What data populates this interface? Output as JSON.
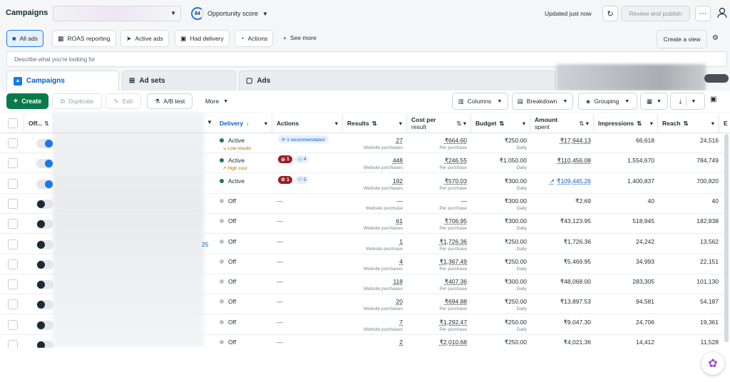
{
  "header": {
    "title": "Campaigns",
    "opportunity_score_value": "84",
    "opportunity_score_label": "Opportunity score",
    "updated_text": "Updated just now",
    "review_publish_label": "Review and publish",
    "more_label": "···"
  },
  "filters": {
    "tabs": [
      {
        "label": "All ads",
        "icon": "folder-icon"
      },
      {
        "label": "ROAS reporting",
        "icon": "report-icon"
      },
      {
        "label": "Active ads",
        "icon": "send-icon"
      },
      {
        "label": "Had delivery",
        "icon": "box-icon"
      },
      {
        "label": "Actions",
        "icon": "actions-icon"
      }
    ],
    "see_more_label": "See more",
    "create_view_label": "Create a view"
  },
  "search": {
    "placeholder": "Describe what you're looking for"
  },
  "level_tabs": [
    {
      "label": "Campaigns"
    },
    {
      "label": "Ad sets"
    },
    {
      "label": "Ads"
    }
  ],
  "toolbar": {
    "create_label": "Create",
    "duplicate_label": "Duplicate",
    "edit_label": "Edit",
    "ab_test_label": "A/B test",
    "more_label": "More",
    "columns_label": "Columns",
    "breakdown_label": "Breakdown",
    "grouping_label": "Grouping"
  },
  "table": {
    "columns": {
      "off": "Off...",
      "delivery": "Delivery",
      "actions": "Actions",
      "results": "Results",
      "cost_per_result_line1": "Cost per",
      "cost_per_result_line2": "result",
      "budget": "Budget",
      "amount_spent_line1": "Amount",
      "amount_spent_line2": "spent",
      "impressions": "Impressions",
      "reach": "Reach",
      "extra": "E"
    },
    "rows": [
      {
        "toggle": "on",
        "id_text": "",
        "delivery": "Active",
        "delivery_note": "↘ Low results",
        "actions_kind": "recommendation",
        "rec_text": "⟳ 1 recommendation",
        "red_count": "",
        "people_count": "",
        "results": "27",
        "results_sub": "Website purchases",
        "cost": "₹664.60",
        "cost_sub": "Per purchase",
        "budget": "₹250.00",
        "budget_sub": "Daily",
        "amount": "₹17,944.13",
        "amount_trend": false,
        "impressions": "66,618",
        "reach": "24,516"
      },
      {
        "toggle": "on",
        "id_text": "",
        "delivery": "Active",
        "delivery_note": "↗ High cost",
        "actions_kind": "badges",
        "rec_text": "",
        "red_count": "1",
        "people_count": "4",
        "results": "448",
        "results_sub": "Website purchases",
        "cost": "₹246.55",
        "cost_sub": "Per purchase",
        "budget": "₹1,050.00",
        "budget_sub": "Daily",
        "amount": "₹110,456.08",
        "amount_trend": false,
        "impressions": "1,554,670",
        "reach": "784,749"
      },
      {
        "toggle": "on",
        "id_text": "",
        "delivery": "Active",
        "delivery_note": "",
        "actions_kind": "badges",
        "rec_text": "",
        "red_count": "1",
        "people_count": "5",
        "results": "192",
        "results_sub": "Website purchases",
        "cost": "₹570.03",
        "cost_sub": "Per purchase",
        "budget": "₹300.00",
        "budget_sub": "Daily",
        "amount": "₹109,445.26",
        "amount_trend": true,
        "impressions": "1,400,837",
        "reach": "700,820"
      },
      {
        "toggle": "off",
        "id_text": "",
        "delivery": "Off",
        "delivery_note": "",
        "actions_kind": "dash",
        "rec_text": "",
        "red_count": "",
        "people_count": "",
        "results": "—",
        "results_sub": "Website purchase",
        "cost": "—",
        "cost_sub": "Per purchase",
        "budget": "₹300.00",
        "budget_sub": "Daily",
        "amount": "₹2.69",
        "amount_trend": false,
        "impressions": "40",
        "reach": "40"
      },
      {
        "toggle": "off",
        "id_text": "",
        "delivery": "Off",
        "delivery_note": "",
        "actions_kind": "dash",
        "rec_text": "",
        "red_count": "",
        "people_count": "",
        "results": "61",
        "results_sub": "Website purchases",
        "cost": "₹706.95",
        "cost_sub": "Per purchase",
        "budget": "₹300.00",
        "budget_sub": "Daily",
        "amount": "₹43,123.95",
        "amount_trend": false,
        "impressions": "518,945",
        "reach": "182,838"
      },
      {
        "toggle": "off",
        "id_text": "25",
        "delivery": "Off",
        "delivery_note": "",
        "actions_kind": "dash",
        "rec_text": "",
        "red_count": "",
        "people_count": "",
        "results": "1",
        "results_sub": "Website purchase",
        "cost": "₹1,726.36",
        "cost_sub": "Per purchase",
        "budget": "₹250.00",
        "budget_sub": "Daily",
        "amount": "₹1,726.36",
        "amount_trend": false,
        "impressions": "24,242",
        "reach": "13,562"
      },
      {
        "toggle": "off",
        "id_text": "",
        "delivery": "Off",
        "delivery_note": "",
        "actions_kind": "dash",
        "rec_text": "",
        "red_count": "",
        "people_count": "",
        "results": "4",
        "results_sub": "Website purchases",
        "cost": "₹1,367.49",
        "cost_sub": "Per purchase",
        "budget": "₹250.00",
        "budget_sub": "Daily",
        "amount": "₹5,469.95",
        "amount_trend": false,
        "impressions": "34,993",
        "reach": "22,151"
      },
      {
        "toggle": "off",
        "id_text": "",
        "delivery": "Off",
        "delivery_note": "",
        "actions_kind": "dash",
        "rec_text": "",
        "red_count": "",
        "people_count": "",
        "results": "118",
        "results_sub": "Website purchases",
        "cost": "₹407.36",
        "cost_sub": "Per purchase",
        "budget": "₹300.00",
        "budget_sub": "Daily",
        "amount": "₹48,068.00",
        "amount_trend": false,
        "impressions": "283,305",
        "reach": "101,130"
      },
      {
        "toggle": "off",
        "id_text": "",
        "delivery": "Off",
        "delivery_note": "",
        "actions_kind": "dash",
        "rec_text": "",
        "red_count": "",
        "people_count": "",
        "results": "20",
        "results_sub": "Website purchases",
        "cost": "₹694.88",
        "cost_sub": "Per purchase",
        "budget": "₹250.00",
        "budget_sub": "Daily",
        "amount": "₹13,897.53",
        "amount_trend": false,
        "impressions": "94,581",
        "reach": "54,187"
      },
      {
        "toggle": "off",
        "id_text": "",
        "delivery": "Off",
        "delivery_note": "",
        "actions_kind": "dash",
        "rec_text": "",
        "red_count": "",
        "people_count": "",
        "results": "7",
        "results_sub": "Website purchases",
        "cost": "₹1,292.47",
        "cost_sub": "Per purchase",
        "budget": "₹250.00",
        "budget_sub": "Daily",
        "amount": "₹9,047.30",
        "amount_trend": false,
        "impressions": "24,706",
        "reach": "19,361"
      },
      {
        "toggle": "off",
        "id_text": "",
        "delivery": "Off",
        "delivery_note": "",
        "actions_kind": "dash",
        "rec_text": "",
        "red_count": "",
        "people_count": "",
        "results": "2",
        "results_sub": "",
        "cost": "₹2,010.68",
        "cost_sub": "",
        "budget": "₹250.00",
        "budget_sub": "",
        "amount": "₹4,021.36",
        "amount_trend": false,
        "impressions": "14,412",
        "reach": "11,528"
      }
    ]
  },
  "colors": {
    "accent": "#1877f2",
    "create_green": "#0a7a4a",
    "alert_red": "#9b1c28",
    "active_green": "#1f7a4a"
  }
}
